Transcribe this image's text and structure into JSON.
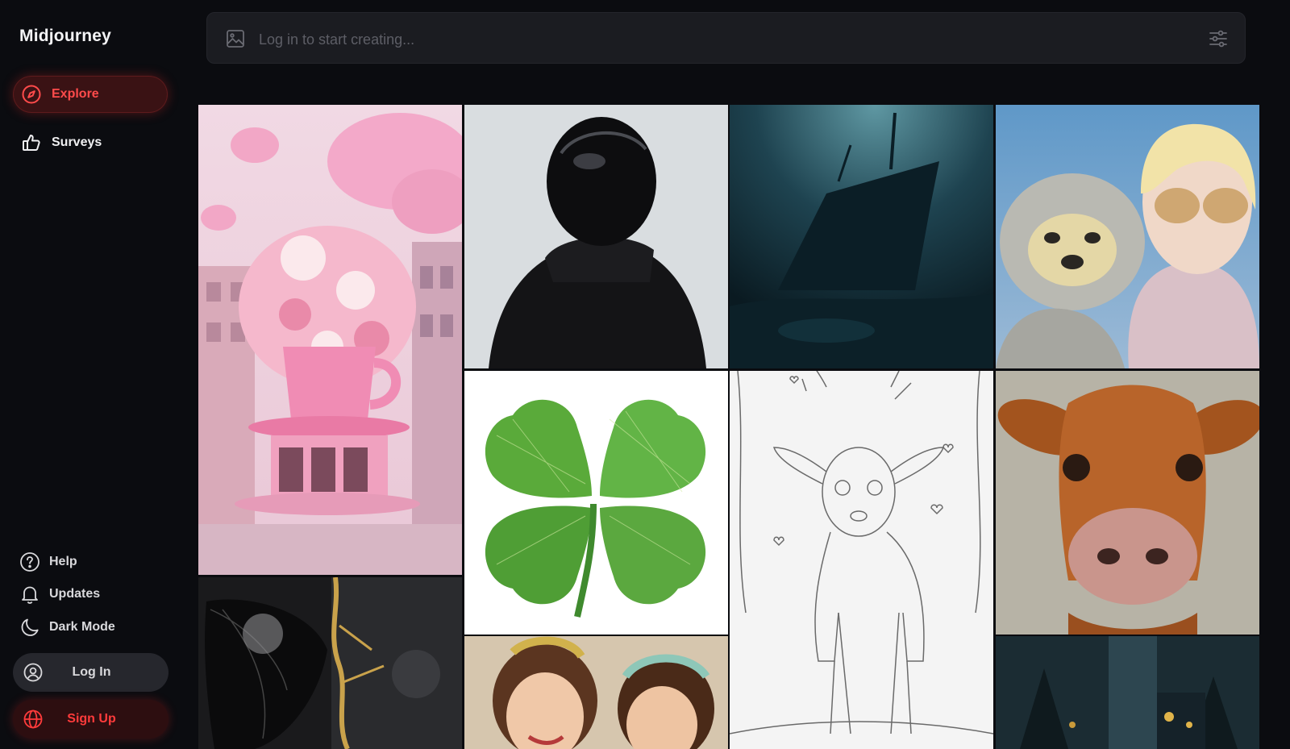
{
  "app": {
    "title": "Midjourney"
  },
  "nav": {
    "explore": {
      "label": "Explore",
      "icon": "compass-icon",
      "active": true
    },
    "surveys": {
      "label": "Surveys",
      "icon": "thumbs-up-icon"
    }
  },
  "bottom_nav": {
    "help": {
      "label": "Help",
      "icon": "help-circle-icon"
    },
    "updates": {
      "label": "Updates",
      "icon": "bell-icon"
    },
    "dark_mode": {
      "label": "Dark Mode",
      "icon": "moon-icon"
    }
  },
  "auth": {
    "login": {
      "label": "Log In",
      "icon": "user-circle-icon"
    },
    "signup": {
      "label": "Sign Up",
      "icon": "globe-icon"
    }
  },
  "search": {
    "placeholder": "Log in to start creating...",
    "value": "",
    "left_icon": "image-icon",
    "right_icon": "sliders-icon"
  },
  "gallery": {
    "images": [
      {
        "id": "pink-teacup-cafe",
        "subject": "pink teacup cafe with flowers"
      },
      {
        "id": "helmet-figure",
        "subject": "figure in black helmet and hoodie"
      },
      {
        "id": "sunken-ship",
        "subject": "underwater shipwreck"
      },
      {
        "id": "sloth-and-woman",
        "subject": "glitter sloth and woman with sunglasses"
      },
      {
        "id": "mirror-clover",
        "subject": "disco mirror four-leaf clover"
      },
      {
        "id": "deer-coloring",
        "subject": "deer coloring page"
      },
      {
        "id": "cow-portrait",
        "subject": "close-up cow"
      },
      {
        "id": "butterfly-gold",
        "subject": "black butterfly with gold cracks"
      },
      {
        "id": "retro-women",
        "subject": "two retro pin-up women"
      },
      {
        "id": "night-forest",
        "subject": "dark night scene with trees"
      }
    ]
  },
  "colors": {
    "accent": "#ff4b4b",
    "background": "#0b0c10",
    "search_bg": "#1b1c21"
  }
}
